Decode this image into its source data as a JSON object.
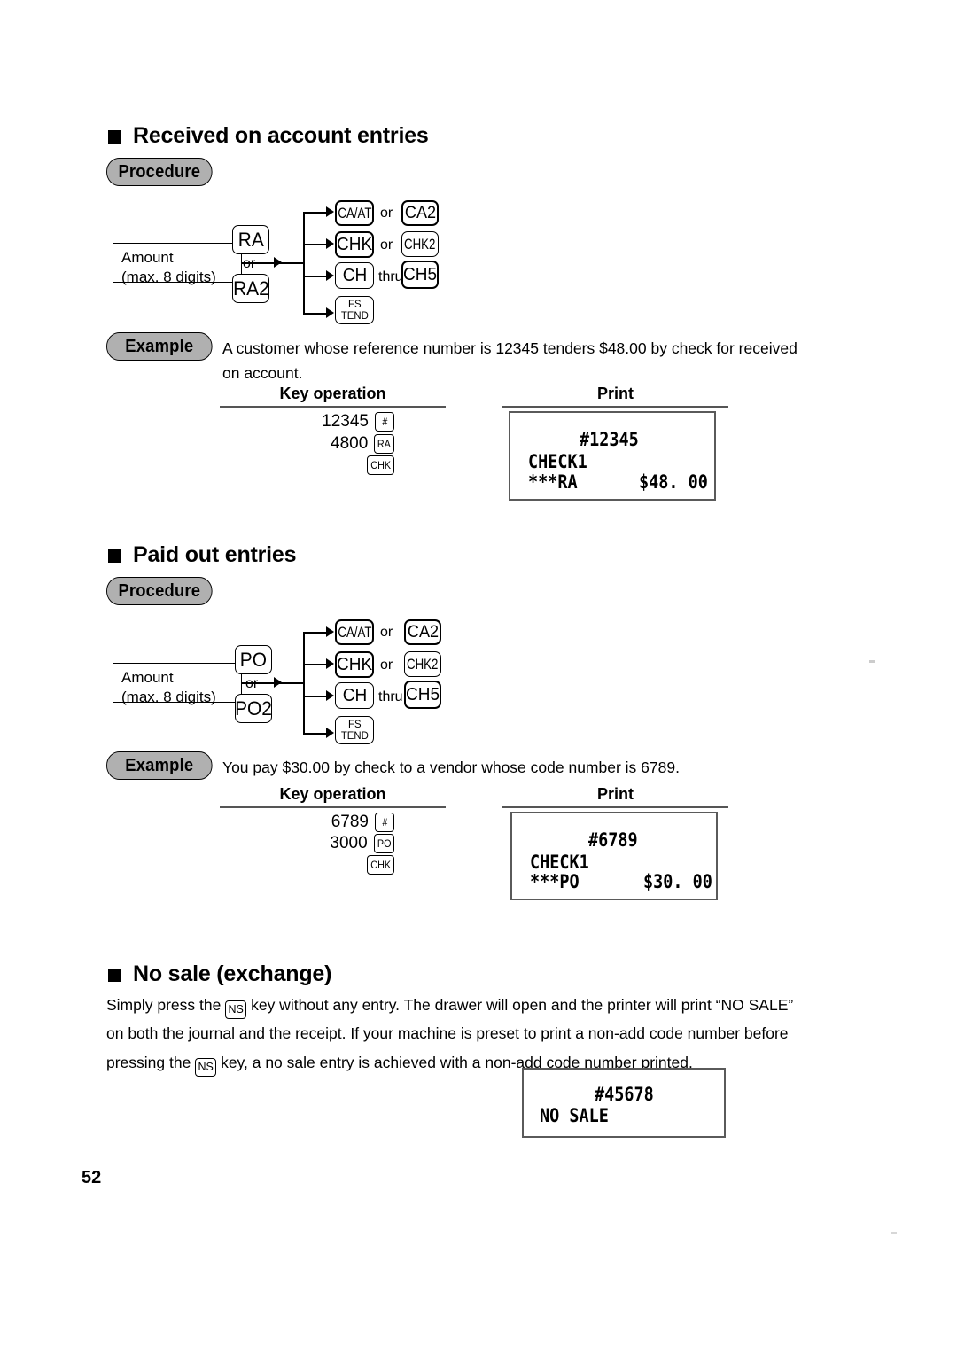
{
  "page": {
    "number": "52"
  },
  "sections": [
    {
      "id": "received-on-account",
      "heading": "Received on account entries",
      "procedure_badge": "Procedure",
      "example_badge": "Example",
      "example_text": "A customer whose reference number is 12345 tenders $48.00 by check for received on account.",
      "diagram": {
        "amount_box": {
          "line1": "Amount",
          "line2": "(max. 8 digits)"
        },
        "primary_keys": [
          "RA",
          "RA2"
        ],
        "primary_conjunction": "or",
        "tender_rows": [
          {
            "key": "CA/AT",
            "conjunction": "or",
            "alt_key": "CA2"
          },
          {
            "key": "CHK",
            "conjunction": "or",
            "alt_key": "CHK2"
          },
          {
            "key": "CH",
            "conjunction": "thru",
            "alt_key": "CH5"
          },
          {
            "key": "FS\nTEND",
            "conjunction": "",
            "alt_key": ""
          }
        ]
      },
      "table": {
        "key_operation_header": "Key operation",
        "print_header": "Print",
        "key_operation_rows": [
          {
            "value": "12345",
            "key": "#"
          },
          {
            "value": "4800",
            "key": "RA"
          },
          {
            "value": "",
            "key": "CHK"
          }
        ],
        "receipt_lines": [
          {
            "left": "",
            "center": "#12345",
            "right": ""
          },
          {
            "left": "CHECK1",
            "center": "",
            "right": ""
          },
          {
            "left": "***RA",
            "center": "",
            "right": "$48. 00"
          }
        ]
      }
    },
    {
      "id": "paid-out",
      "heading": "Paid out entries",
      "procedure_badge": "Procedure",
      "example_badge": "Example",
      "example_text": "You pay $30.00 by check to a vendor whose code number is 6789.",
      "diagram": {
        "amount_box": {
          "line1": "Amount",
          "line2": "(max. 8 digits)"
        },
        "primary_keys": [
          "PO",
          "PO2"
        ],
        "primary_conjunction": "or",
        "tender_rows": [
          {
            "key": "CA/AT",
            "conjunction": "or",
            "alt_key": "CA2"
          },
          {
            "key": "CHK",
            "conjunction": "or",
            "alt_key": "CHK2"
          },
          {
            "key": "CH",
            "conjunction": "thru",
            "alt_key": "CH5"
          },
          {
            "key": "FS\nTEND",
            "conjunction": "",
            "alt_key": ""
          }
        ]
      },
      "table": {
        "key_operation_header": "Key operation",
        "print_header": "Print",
        "key_operation_rows": [
          {
            "value": "6789",
            "key": "#"
          },
          {
            "value": "3000",
            "key": "PO"
          },
          {
            "value": "",
            "key": "CHK"
          }
        ],
        "receipt_lines": [
          {
            "left": "",
            "center": "#6789",
            "right": ""
          },
          {
            "left": "CHECK1",
            "center": "",
            "right": ""
          },
          {
            "left": "***PO",
            "center": "",
            "right": "$30. 00"
          }
        ]
      }
    },
    {
      "id": "no-sale",
      "heading": "No sale (exchange)",
      "paragraph": {
        "part1": "Simply press the ",
        "key1": "NS",
        "part2": " key without any entry.  The drawer will open and the printer will print “NO SALE” on both the journal and the receipt.  If your machine is preset to print a non-add code number before pressing the ",
        "key2": "NS",
        "part3": " key, a no sale entry is achieved with a non-add code number printed."
      },
      "receipt_lines": [
        {
          "left": "",
          "center": "#45678",
          "right": ""
        },
        {
          "left": "NO SALE",
          "center": "",
          "right": ""
        }
      ]
    }
  ],
  "colors": {
    "badge_fill": "#b0b0b0",
    "text": "#000000",
    "receipt_border": "#5a5a5a",
    "rule": "#555555"
  }
}
